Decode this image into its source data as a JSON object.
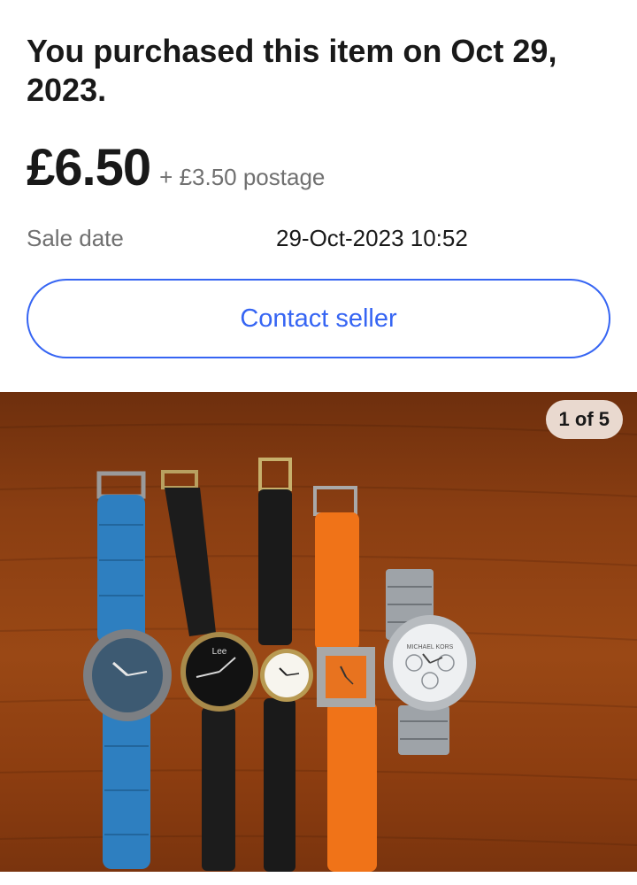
{
  "purchase": {
    "message": "You purchased this item on Oct 29, 2023."
  },
  "price": {
    "amount": "£6.50",
    "postage": "+ £3.50 postage"
  },
  "sale": {
    "label": "Sale date",
    "value": "29-Oct-2023 10:52"
  },
  "actions": {
    "contact_seller": "Contact seller"
  },
  "gallery": {
    "counter": "1 of 5",
    "watch_brands": {
      "watch2": "Lee",
      "watch5": "MICHAEL KORS"
    }
  },
  "colors": {
    "accent": "#3665f3",
    "text": "#191919",
    "muted": "#707070"
  }
}
